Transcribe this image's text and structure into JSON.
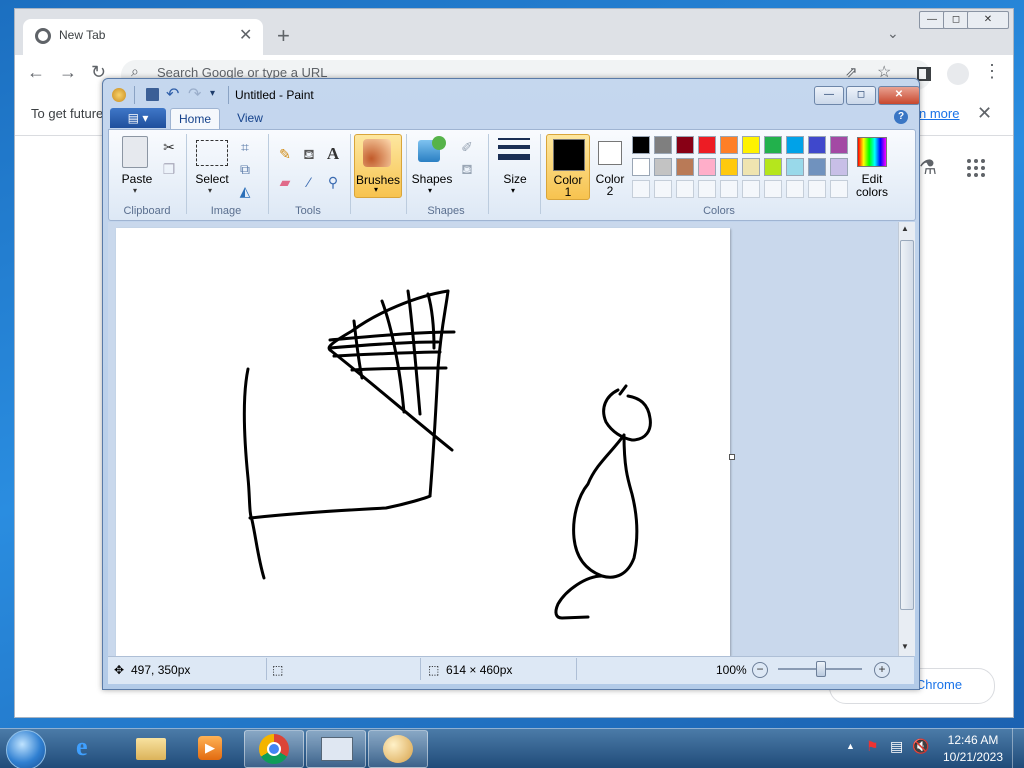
{
  "chrome": {
    "tab_title": "New Tab",
    "omnibox_placeholder": "Search Google or type a URL",
    "infobar_text": "To get future",
    "infobar_link": "n more",
    "customize_label": "e Chrome"
  },
  "paint": {
    "title": "Untitled - Paint",
    "tabs": {
      "home": "Home",
      "view": "View"
    },
    "groups": {
      "clipboard": "Clipboard",
      "image": "Image",
      "tools": "Tools",
      "shapes": "Shapes",
      "colors": "Colors"
    },
    "buttons": {
      "paste": "Paste",
      "select": "Select",
      "brushes": "Brushes",
      "shapes": "Shapes",
      "size": "Size",
      "color1": "Color",
      "color1_num": "1",
      "color2": "Color",
      "color2_num": "2",
      "edit_colors_1": "Edit",
      "edit_colors_2": "colors"
    },
    "palette_row1": [
      "#000000",
      "#7f7f7f",
      "#880015",
      "#ed1c24",
      "#ff7f27",
      "#fff200",
      "#22b14c",
      "#00a2e8",
      "#3f48cc",
      "#a349a4"
    ],
    "palette_row2": [
      "#ffffff",
      "#c3c3c3",
      "#b97a57",
      "#ffaec9",
      "#ffc90e",
      "#efe4b0",
      "#b5e61d",
      "#99d9ea",
      "#7092be",
      "#c8bfe7"
    ],
    "color1_value": "#000000",
    "color2_value": "#ffffff",
    "status": {
      "cursor_pos": "497, 350px",
      "canvas_size": "614 × 460px",
      "zoom": "100%"
    }
  },
  "taskbar": {
    "time": "12:46 AM",
    "date": "10/21/2023"
  }
}
